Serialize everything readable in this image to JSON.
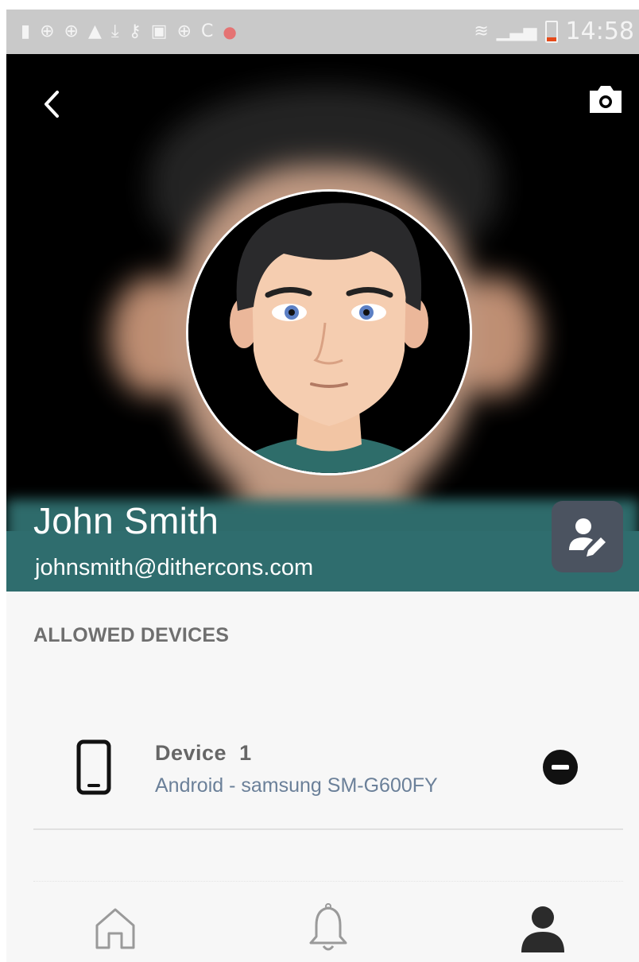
{
  "status_bar": {
    "time": "14:58",
    "left_icons": [
      "battery-saver-icon",
      "app-icon",
      "app-icon",
      "warning-icon",
      "download-icon",
      "key-icon",
      "image-icon",
      "app-icon",
      "c-icon",
      "red-app-icon"
    ],
    "right_icons": [
      "wifi-icon",
      "signal-icon",
      "battery-icon"
    ]
  },
  "header": {
    "back_icon": "chevron-left-icon",
    "camera_icon": "camera-icon",
    "name": "John Smith",
    "email": "johnsmith@dithercons.com",
    "edit_icon": "edit-profile-icon",
    "colors": {
      "background": "#000000",
      "teal": "#2f6d6e",
      "edit_button": "#4b5360"
    }
  },
  "devices": {
    "section_title": "ALLOWED DEVICES",
    "items": [
      {
        "name": "Device  1",
        "description": "Android - samsung SM-G600FY",
        "icon": "phone-icon",
        "action_icon": "remove-icon"
      }
    ]
  },
  "tabbar": {
    "items": [
      {
        "icon": "home-icon",
        "active": false
      },
      {
        "icon": "bell-icon",
        "active": false
      },
      {
        "icon": "profile-icon",
        "active": true
      }
    ],
    "colors": {
      "active": "#2b2b2b",
      "inactive": "#9a9a9a"
    }
  }
}
